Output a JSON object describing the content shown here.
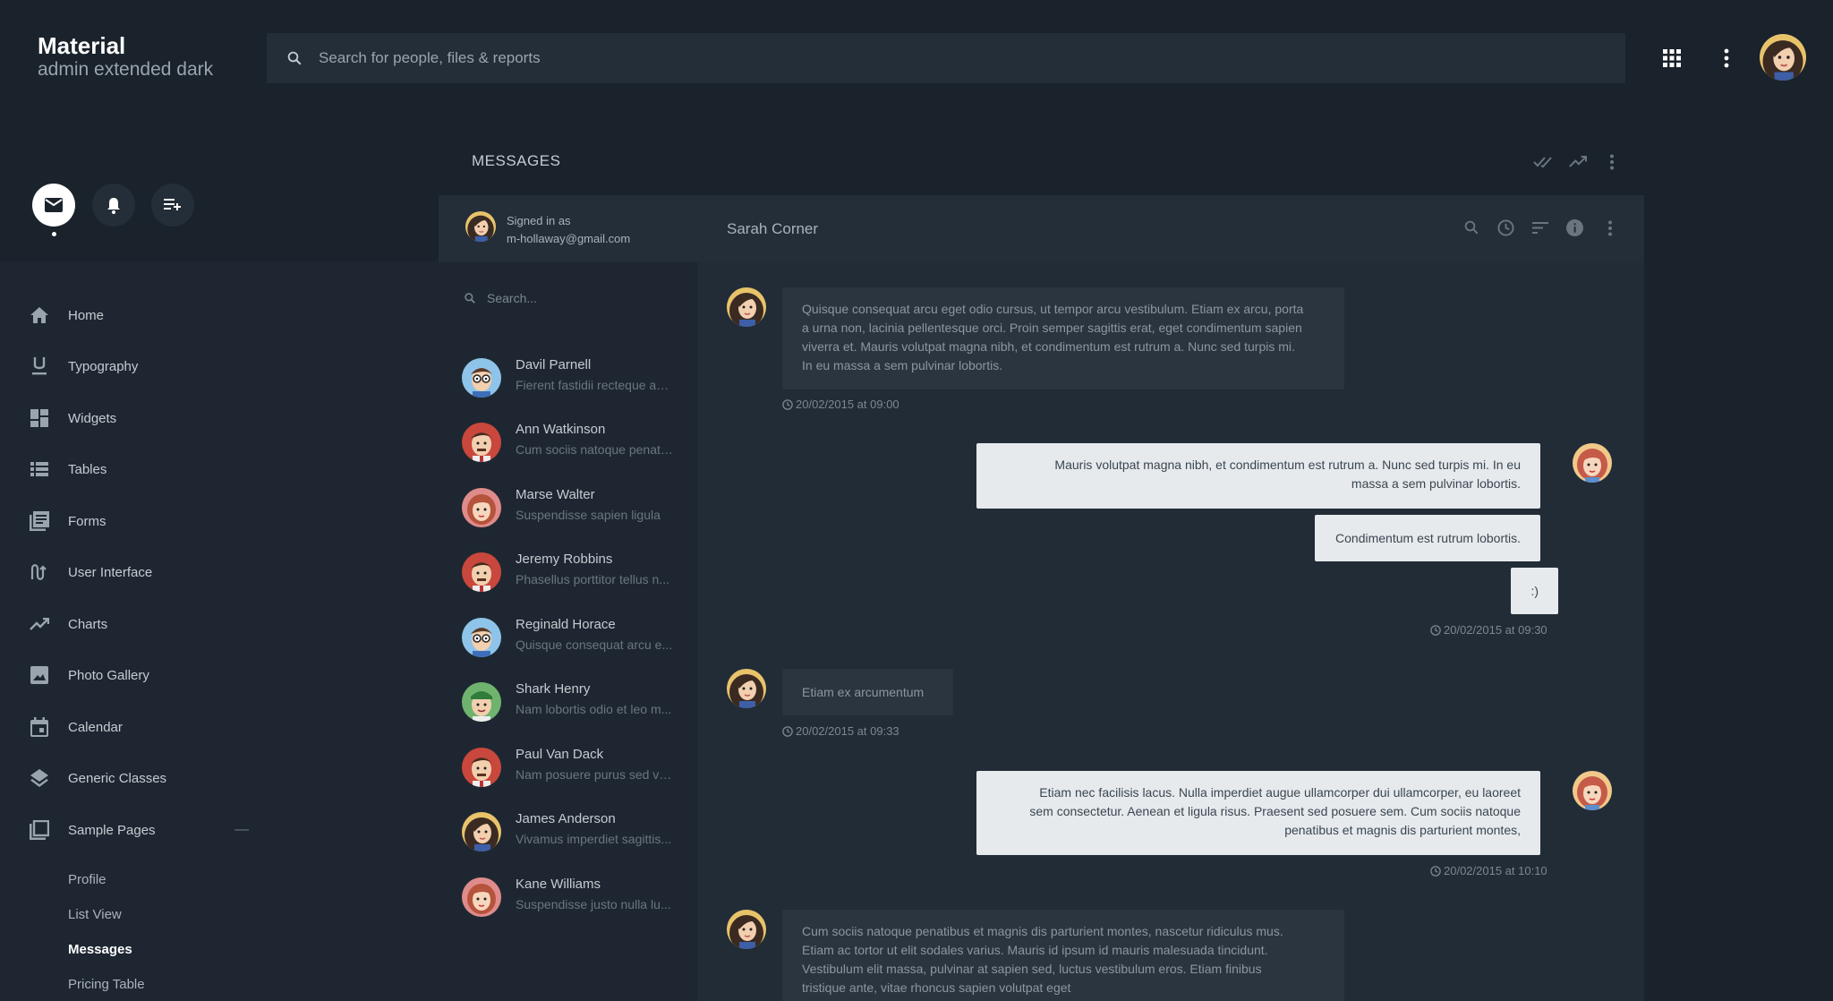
{
  "brand": {
    "title": "Material",
    "subtitle": "admin extended dark"
  },
  "search": {
    "placeholder": "Search for people, files & reports"
  },
  "nav": {
    "items": [
      {
        "label": "Home",
        "icon": "home-icon"
      },
      {
        "label": "Typography",
        "icon": "underline-icon"
      },
      {
        "label": "Widgets",
        "icon": "dashboard-icon"
      },
      {
        "label": "Tables",
        "icon": "list-icon"
      },
      {
        "label": "Forms",
        "icon": "forms-icon"
      },
      {
        "label": "User Interface",
        "icon": "gesture-icon"
      },
      {
        "label": "Charts",
        "icon": "trending-icon"
      },
      {
        "label": "Photo Gallery",
        "icon": "image-icon"
      },
      {
        "label": "Calendar",
        "icon": "calendar-icon"
      },
      {
        "label": "Generic Classes",
        "icon": "layers-icon"
      },
      {
        "label": "Sample Pages",
        "icon": "pages-icon",
        "collapse": "—"
      }
    ],
    "sub_items": [
      {
        "label": "Profile"
      },
      {
        "label": "List View"
      },
      {
        "label": "Messages",
        "active": true
      },
      {
        "label": "Pricing Table"
      }
    ]
  },
  "messages": {
    "title": "MESSAGES",
    "signed_in_label": "Signed in as",
    "signed_in_email": "m-hollaway@gmail.com",
    "contact_search_placeholder": "Search...",
    "conversation_title": "Sarah Corner",
    "contacts": [
      {
        "name": "Davil Parnell",
        "preview": "Fierent fastidii recteque ad..."
      },
      {
        "name": "Ann Watkinson",
        "preview": "Cum sociis natoque penati..."
      },
      {
        "name": "Marse Walter",
        "preview": "Suspendisse sapien ligula"
      },
      {
        "name": "Jeremy Robbins",
        "preview": "Phasellus porttitor tellus n..."
      },
      {
        "name": "Reginald Horace",
        "preview": "Quisque consequat arcu e..."
      },
      {
        "name": "Shark Henry",
        "preview": "Nam lobortis odio et leo m..."
      },
      {
        "name": "Paul Van Dack",
        "preview": "Nam posuere purus sed ve..."
      },
      {
        "name": "James Anderson",
        "preview": "Vivamus imperdiet sagittis..."
      },
      {
        "name": "Kane Williams",
        "preview": "Suspendisse justo nulla lu..."
      }
    ],
    "thread": [
      {
        "lines": [
          "Quisque consequat arcu eget odio cursus, ut tempor arcu vestibulum. Etiam ex arcu, porta",
          "a urna non, lacinia pellentesque orci. Proin semper sagittis erat, eget condimentum sapien",
          "viverra et. Mauris volutpat magna nibh, et condimentum est rutrum a. Nunc sed turpis mi.",
          "In eu massa a sem pulvinar lobortis."
        ],
        "time": "20/02/2015 at 09:00"
      },
      {
        "lines": [
          "Mauris volutpat magna nibh, et condimentum est rutrum a. Nunc sed turpis mi. In eu",
          "massa a sem pulvinar lobortis."
        ]
      },
      {
        "text": "Condimentum est rutrum lobortis."
      },
      {
        "text": ":)",
        "time": "20/02/2015 at 09:30"
      },
      {
        "text": "Etiam ex arcumentum",
        "time": "20/02/2015 at 09:33"
      },
      {
        "lines": [
          "Etiam nec facilisis lacus. Nulla imperdiet augue ullamcorper dui ullamcorper, eu laoreet",
          "sem consectetur. Aenean et ligula risus. Praesent sed posuere sem. Cum sociis natoque",
          "penatibus et magnis dis parturient montes,"
        ],
        "time": "20/02/2015 at 10:10"
      },
      {
        "lines": [
          "Cum sociis natoque penatibus et magnis dis parturient montes, nascetur ridiculus mus.",
          "Etiam ac tortor ut elit sodales varius. Mauris id ipsum id mauris malesuada tincidunt.",
          "Vestibulum elit massa, pulvinar at sapien sed, luctus vestibulum eros. Etiam finibus",
          "tristique ante, vitae rhoncus sapien volutpat eget"
        ]
      }
    ]
  },
  "colors": {
    "background": "#1a222b",
    "panel": "#222c37",
    "outgoing_bubble": "#e6eaed",
    "incoming_bubble": "#2b3540"
  }
}
